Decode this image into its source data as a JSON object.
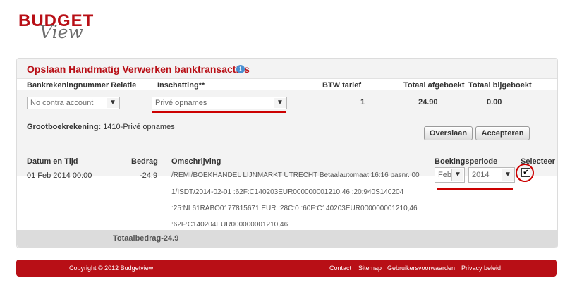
{
  "logo": {
    "line1": "BUDGET",
    "line2": "View"
  },
  "panel": {
    "title": "Opslaan Handmatig Verwerken banktransacties",
    "info_icon": "i"
  },
  "top_table": {
    "headers": {
      "account": "Bankrekeningnummer Relatie",
      "estimate": "Inschatting**",
      "vat": "BTW tarief",
      "booked_off": "Totaal afgeboekt",
      "booked_on": "Totaal bijgeboekt"
    },
    "account_select": "No contra account",
    "estimate_select": "Privé opnames",
    "vat_value": "1",
    "booked_off_value": "24.90",
    "booked_on_value": "0.00",
    "ledger_label": "Grootboekrekening:",
    "ledger_value": "1410-Privé opnames",
    "skip_button": "Overslaan",
    "accept_button": "Accepteren"
  },
  "transactions": {
    "headers": {
      "date": "Datum en Tijd",
      "amount": "Bedrag",
      "description": "Omschrijving",
      "period": "Boekingsperiode",
      "select": "Selecteer"
    },
    "rows": [
      {
        "date": "01 Feb 2014 00:00",
        "amount": "-24.9",
        "description_lines": [
          "/REMI/BOEKHANDEL LIJNMARKT UTRECHT Betaalautomaat 16:16 pasnr. 00",
          "1/ISDT/2014-02-01 :62F:C140203EUR000000001210,46 :20:940S140204",
          ":25:NL61RABO0177815671 EUR :28C:0 :60F:C140203EUR000000001210,46",
          ":62F:C140204EUR000000001210,46"
        ],
        "period_month": "Feb",
        "period_year": "2014",
        "selected_mark": "✔"
      }
    ],
    "total_label": "Totaalbedrag-24.9"
  },
  "footer": {
    "copyright": "Copyright © 2012 Budgetview",
    "links": [
      "Contact",
      "Sitemap",
      "Gebruikersvoorwaarden",
      "Privacy beleid"
    ]
  },
  "colors": {
    "brand_red": "#b80f16",
    "annotation_red": "#cc0000",
    "info_blue": "#4a8fd1"
  }
}
